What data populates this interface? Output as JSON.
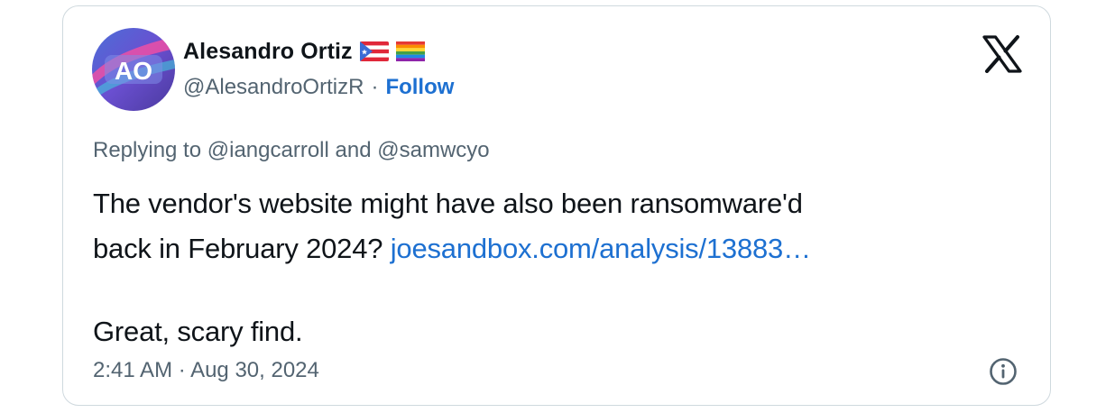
{
  "author": {
    "avatar_initials": "AO",
    "name": "Alesandro Ortiz",
    "flags": [
      "puerto-rico-flag-icon",
      "rainbow-flag-icon"
    ],
    "handle": "@AlesandroOrtizR",
    "separator": "·",
    "follow_label": "Follow"
  },
  "platform_icon": "x-logo-icon",
  "reply": {
    "prefix": "Replying to",
    "mention_1": "@iangcarroll",
    "conjunction": "and",
    "mention_2": "@samwcyo"
  },
  "tweet": {
    "line_1": "The vendor's website might have also been ransomware'd",
    "line_2_text": "back in February 2024?",
    "link_text": "joesandbox.com/analysis/13883…",
    "line_3": "Great, scary find."
  },
  "meta": {
    "time": "2:41 AM",
    "separator": "·",
    "date": "Aug 30, 2024",
    "info_icon": "info-icon"
  },
  "colors": {
    "link": "#1d70d1",
    "secondary_text": "#536471",
    "primary_text": "#0f1419",
    "border": "#cfd9de"
  }
}
